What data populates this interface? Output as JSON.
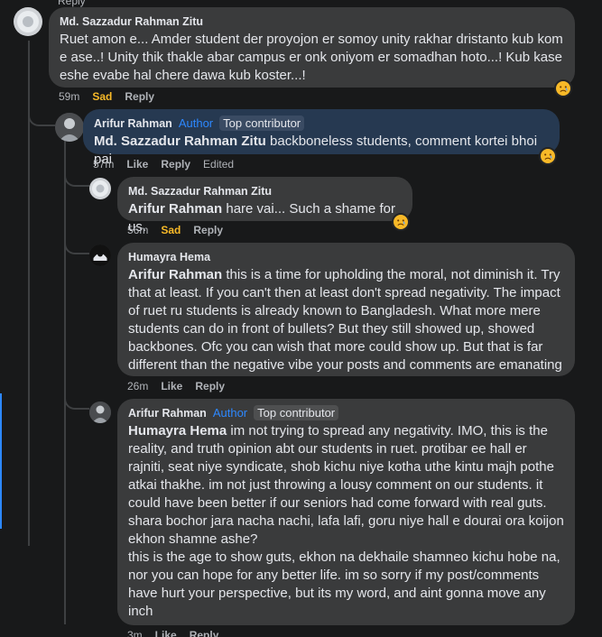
{
  "comments": [
    {
      "author": "Md. Sazzadur Rahman Zitu",
      "text": "Ruet amon e... Amder student der proyojon er somoy unity rakhar dristanto kub kom e ase..! Unity thik thakle abar campus er onk oniyom er somadhan hoto...! Kub kase eshe evabe hal chere dawa kub koster...!",
      "time": "59m",
      "reaction_label": "Sad",
      "reply_label": "Reply"
    },
    {
      "author": "Arifur Rahman",
      "author_badge": "Author",
      "contributor_badge": "Top contributor",
      "mention": "Md. Sazzadur Rahman Zitu",
      "text": " backboneless students, comment kortei bhoi pai",
      "time": "57m",
      "like_label": "Like",
      "reply_label": "Reply",
      "edited_label": "Edited"
    },
    {
      "author": "Md. Sazzadur Rahman Zitu",
      "mention": "Arifur Rahman",
      "text": " hare vai... Such a shame for us.",
      "time": "56m",
      "reaction_label": "Sad",
      "reply_label": "Reply"
    },
    {
      "author": "Humayra Hema",
      "mention": "Arifur Rahman",
      "text": " this is a time for upholding the moral, not diminish it. Try that at least. If you can't then at least don't spread negativity. The impact of ruet ru students is already known to Bangladesh. What more mere students can do in front of bullets? But they still showed up, showed backbones. Ofc you can wish that more could show up. But that is far different than the negative vibe your posts and comments are emanating",
      "time": "26m",
      "like_label": "Like",
      "reply_label": "Reply"
    },
    {
      "author": "Arifur Rahman",
      "author_badge": "Author",
      "contributor_badge": "Top contributor",
      "mention": "Humayra Hema",
      "text": " im not trying to spread any negativity. IMO, this is the reality, and truth opinion abt our students in ruet. protibar ee hall er rajniti, seat niye syndicate, shob kichu niye kotha uthe kintu majh pothe atkai thakhe. im not just throwing a lousy comment on our students. it could have been better if our seniors had come forward with real guts. shara bochor jara nacha nachi, lafa lafi, goru niye hall e dourai ora koijon ekhon shamne ashe?",
      "text2": "this is the age to show guts, ekhon na dekhaile shamneo kichu hobe na, nor you can hope for any better life. im so sorry if my post/comments have hurt your perspective, but its my word, and aint gonna move any inch",
      "time": "3m",
      "like_label": "Like",
      "reply_label": "Reply"
    }
  ],
  "top_cut_label": "Reply",
  "colors": {
    "background": "#18191a",
    "bubble": "#3a3b3c",
    "highlight_bubble": "#263951",
    "author_badge": "#2d88ff",
    "sad": "#f7b928"
  },
  "icons": [
    "sad-reaction-icon",
    "avatar-icon"
  ]
}
